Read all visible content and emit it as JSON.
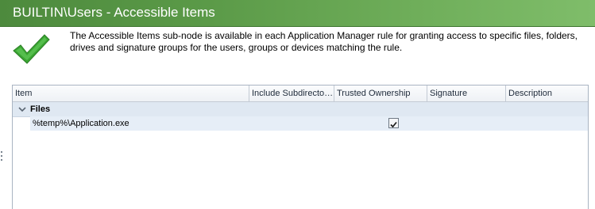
{
  "title": "BUILTIN\\Users - Accessible Items",
  "description": "The Accessible Items sub-node is available in each Application Manager rule for granting access to specific files, folders, drives and signature groups for the users, groups or devices matching the rule.",
  "icons": {
    "info": "checkmark-icon",
    "expander": "chevron-down-icon",
    "row_check": "checkbox-checked"
  },
  "colors": {
    "title_bar": "#5b9a48",
    "check_green": "#3aa632",
    "row_highlight": "#e6eef7"
  },
  "grid": {
    "columns": [
      "Item",
      "Include Subdirecto…",
      "Trusted Ownership",
      "Signature",
      "Description"
    ],
    "groups": [
      {
        "label": "Files",
        "expanded": true,
        "rows": [
          {
            "item": "%temp%\\Application.exe",
            "include_subdirectories": "",
            "trusted_ownership": true,
            "signature": "",
            "description": ""
          }
        ]
      }
    ]
  }
}
